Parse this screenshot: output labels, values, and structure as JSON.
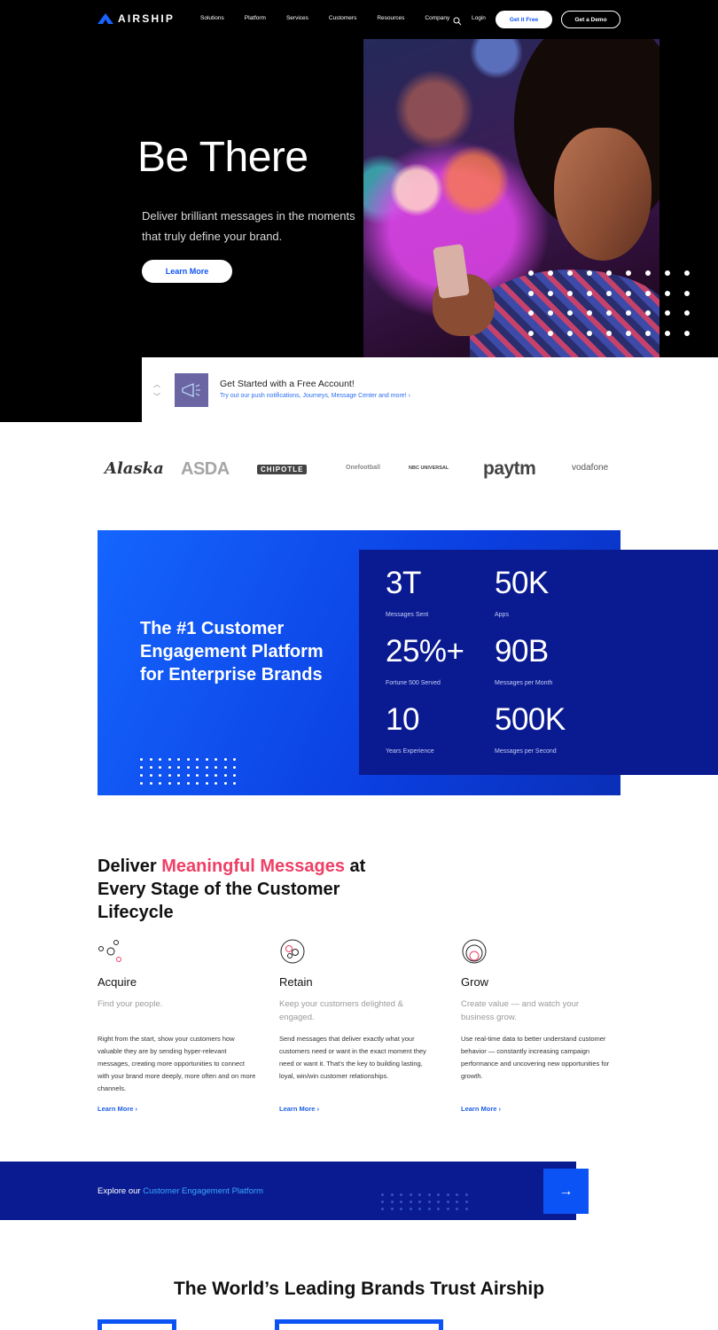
{
  "header": {
    "logo": "AIRSHIP",
    "nav": [
      "Solutions",
      "Platform",
      "Services",
      "Customers",
      "Resources",
      "Company"
    ],
    "login": "Login",
    "cta_primary": "Get it Free",
    "cta_secondary": "Get a Demo"
  },
  "hero": {
    "title": "Be There",
    "subtitle": "Deliver brilliant messages in the moments that truly define your brand.",
    "button": "Learn More"
  },
  "promo": {
    "title": "Get Started with a Free Account!",
    "link": "Try out our push notifications, Journeys, Message Center and more! ›"
  },
  "logos": [
    "Alaska",
    "ASDA",
    "CHIPOTLE",
    "Onefootball",
    "NBC UNIVERSAL",
    "paytm",
    "vodafone"
  ],
  "stats": {
    "heading": "The #1 Customer Engagement Platform for Enterprise Brands",
    "items": [
      {
        "value": "3T",
        "label": "Messages Sent"
      },
      {
        "value": "50K",
        "label": "Apps"
      },
      {
        "value": "25%+",
        "label": "Fortune 500 Served"
      },
      {
        "value": "90B",
        "label": "Messages per Month"
      },
      {
        "value": "10",
        "label": "Years Experience"
      },
      {
        "value": "500K",
        "label": "Messages per Second"
      }
    ]
  },
  "lifecycle": {
    "heading_pre": "Deliver ",
    "heading_accent": "Meaningful Messages",
    "heading_post": " at Every Stage of the Customer Lifecycle",
    "columns": [
      {
        "title": "Acquire",
        "tagline": "Find your people.",
        "body": "Right from the start, show your customers how valuable they are by sending hyper-relevant messages, creating more opportunities to connect with your brand more deeply, more often and on more channels.",
        "link": "Learn More ›"
      },
      {
        "title": "Retain",
        "tagline": "Keep your customers delighted & engaged.",
        "body": "Send messages that deliver exactly what your customers need or want in the exact moment they need or want it. That's the key to building lasting, loyal, win/win customer relationships.",
        "link": "Learn More ›"
      },
      {
        "title": "Grow",
        "tagline": "Create value — and watch your business grow.",
        "body": "Use real-time data to better understand customer behavior — constantly increasing campaign performance and uncovering new opportunities for growth.",
        "link": "Learn More ›"
      }
    ]
  },
  "explore": {
    "pre": "Explore our ",
    "highlight": "Customer Engagement Platform"
  },
  "trust": {
    "heading": "The World’s Leading Brands Trust Airship"
  },
  "colors": {
    "brand_blue": "#0c53f6",
    "navy": "#0a1b92",
    "accent_pink": "#ef3f66"
  }
}
